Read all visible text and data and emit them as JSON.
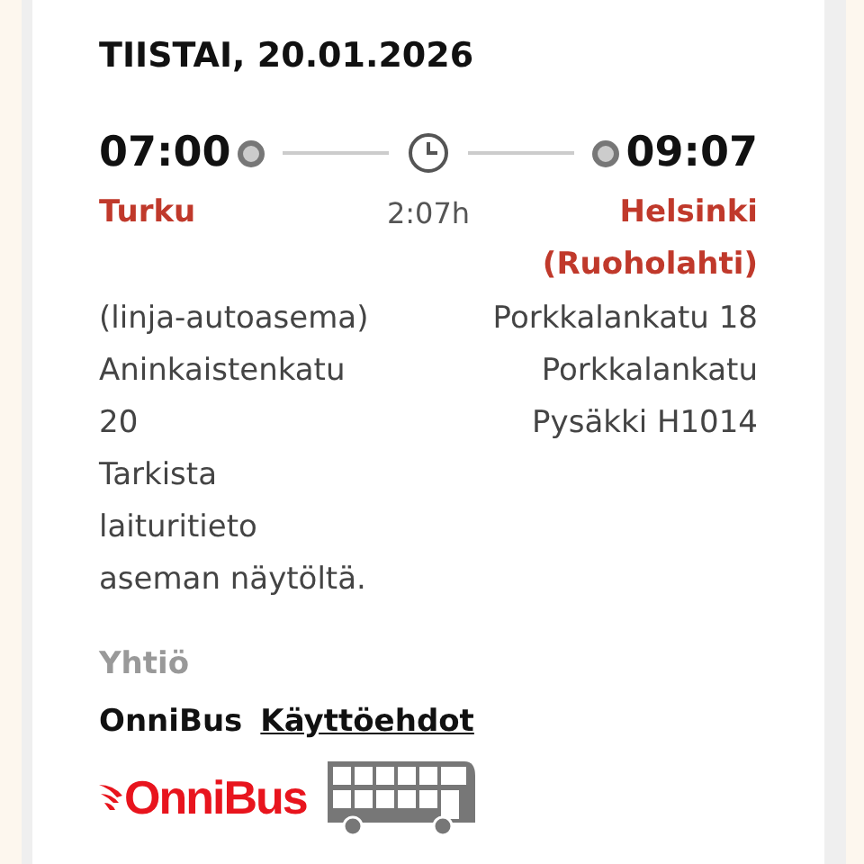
{
  "date": "TIISTAI, 20.01.2026",
  "departure": {
    "time": "07:00",
    "city": "Turku",
    "address_lines": [
      "(linja-autoasema)",
      "Aninkaistenkatu",
      "20",
      "Tarkista",
      "laituritieto",
      "aseman näytöltä."
    ]
  },
  "duration": "2:07h",
  "arrival": {
    "time": "09:07",
    "city": "Helsinki (Ruoholahti)",
    "address_lines": [
      "Porkkalankatu 18",
      "Porkkalankatu",
      "Pysäkki H1014"
    ]
  },
  "company": {
    "label": "Yhtiö",
    "name": "OnniBus",
    "terms_link": "Käyttöehdot",
    "logo_text": "OnniBus"
  }
}
